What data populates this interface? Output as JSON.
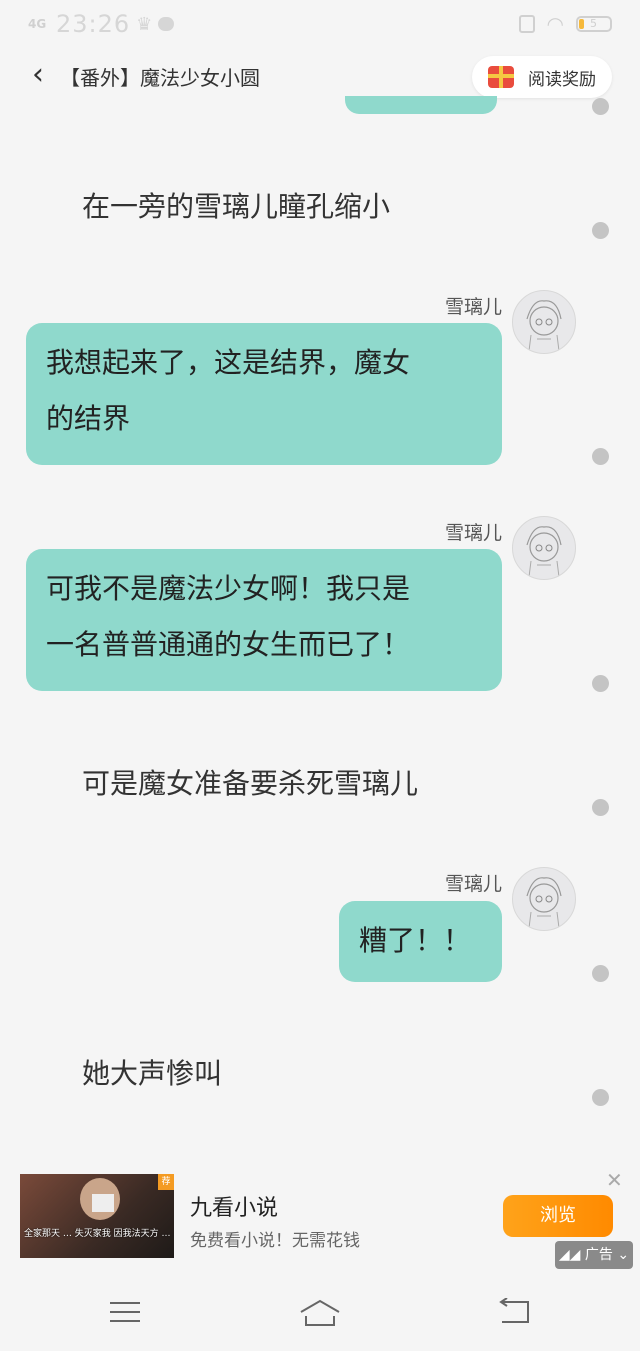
{
  "status_bar": {
    "time": "23:26",
    "signal": "4G",
    "battery": "5"
  },
  "nav": {
    "title": "【番外】魔法少女小圆",
    "reward_label": "阅读奖励"
  },
  "messages": [
    {
      "type": "narration",
      "text": "在一旁的雪璃儿瞳孔缩小"
    },
    {
      "type": "dialogue",
      "speaker": "雪璃儿",
      "lines": [
        "我想起来了，这是结界，魔女",
        "的结界"
      ]
    },
    {
      "type": "dialogue",
      "speaker": "雪璃儿",
      "lines": [
        "可我不是魔法少女啊！我只是",
        "一名普普通通的女生而已了！"
      ]
    },
    {
      "type": "narration",
      "text": "可是魔女准备要杀死雪璃儿"
    },
    {
      "type": "dialogue",
      "speaker": "雪璃儿",
      "lines": [
        "糟了！！"
      ]
    },
    {
      "type": "narration",
      "text": "她大声惨叫"
    }
  ],
  "ad": {
    "title": "九看小说",
    "description": "免费看小说！无需花钱",
    "cta": "浏览",
    "badge": "广告",
    "thumb_caption": "全家那天 … 失灭家我 因我法天方 …"
  },
  "colors": {
    "bubble": "#8fd9cc",
    "cta": "#ff8a00"
  }
}
